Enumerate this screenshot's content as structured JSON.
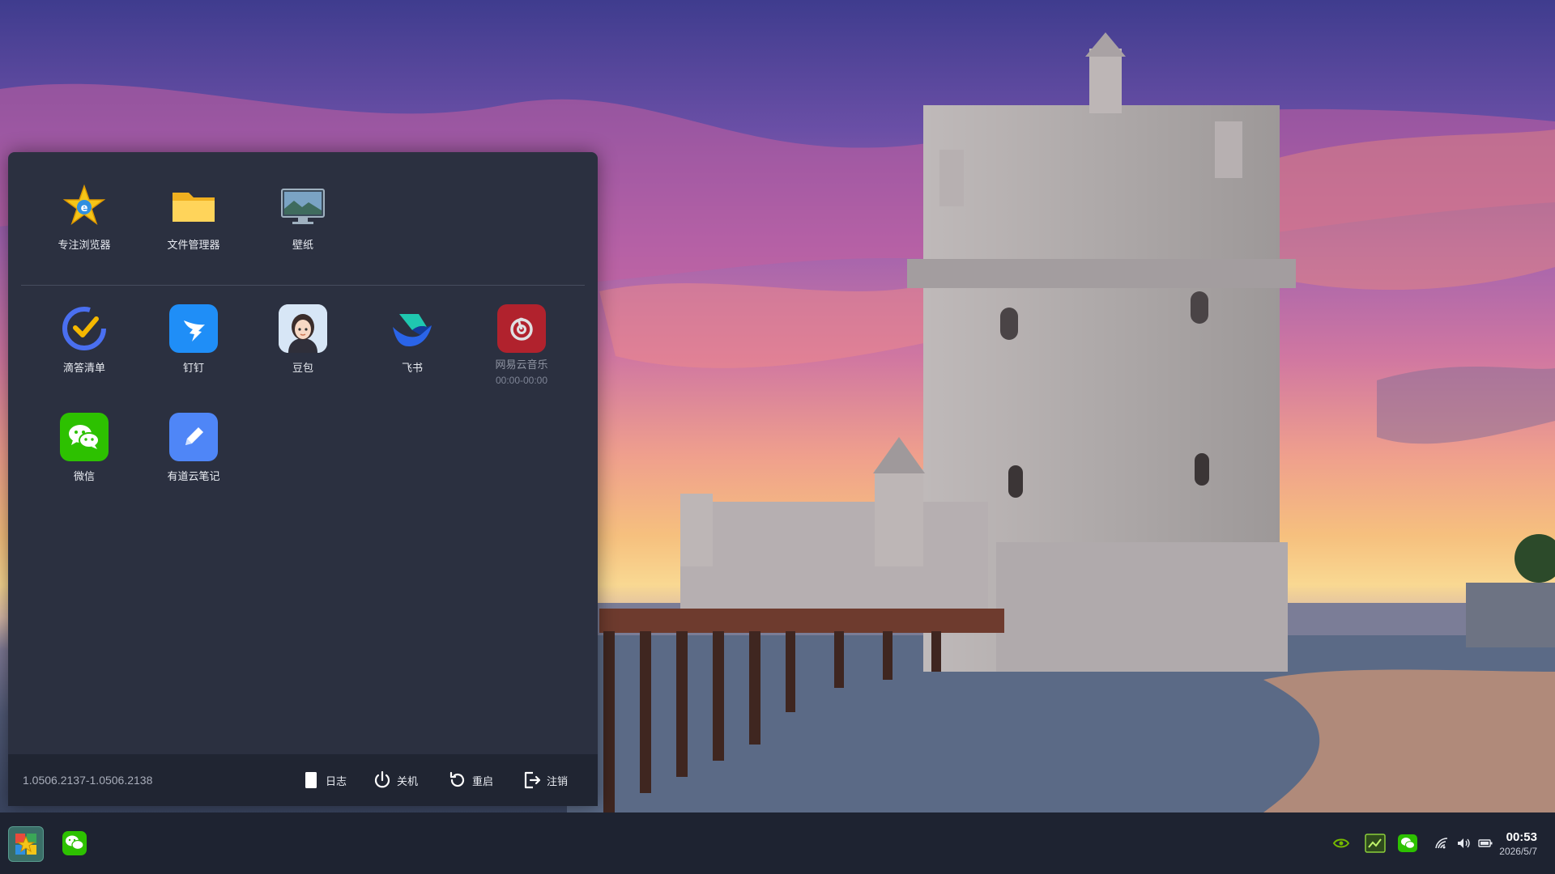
{
  "start_menu": {
    "pinned": [
      {
        "label": "专注浏览器",
        "icon": "browser-star-icon"
      },
      {
        "label": "文件管理器",
        "icon": "folder-icon"
      },
      {
        "label": "壁纸",
        "icon": "monitor-wallpaper-icon"
      }
    ],
    "apps": [
      {
        "label": "滴答清单",
        "icon": "ticktick-icon"
      },
      {
        "label": "钉钉",
        "icon": "dingtalk-icon"
      },
      {
        "label": "豆包",
        "icon": "doubao-avatar-icon"
      },
      {
        "label": "飞书",
        "icon": "feishu-icon"
      },
      {
        "label": "网易云音乐",
        "icon": "netease-music-icon",
        "sub": "00:00-00:00"
      },
      {
        "label": "微信",
        "icon": "wechat-icon"
      },
      {
        "label": "有道云笔记",
        "icon": "youdao-note-icon"
      }
    ],
    "footer": {
      "version": "1.0506.2137-1.0506.2138",
      "log_label": "日志",
      "shutdown_label": "关机",
      "restart_label": "重启",
      "logout_label": "注销"
    }
  },
  "taskbar": {
    "clock_time": "00:53",
    "clock_date": "2026/5/7"
  },
  "colors": {
    "menu_bg": "#2b3040",
    "footer_bg": "#202532",
    "taskbar_bg": "#1e2331",
    "wechat_green": "#2dc100"
  }
}
